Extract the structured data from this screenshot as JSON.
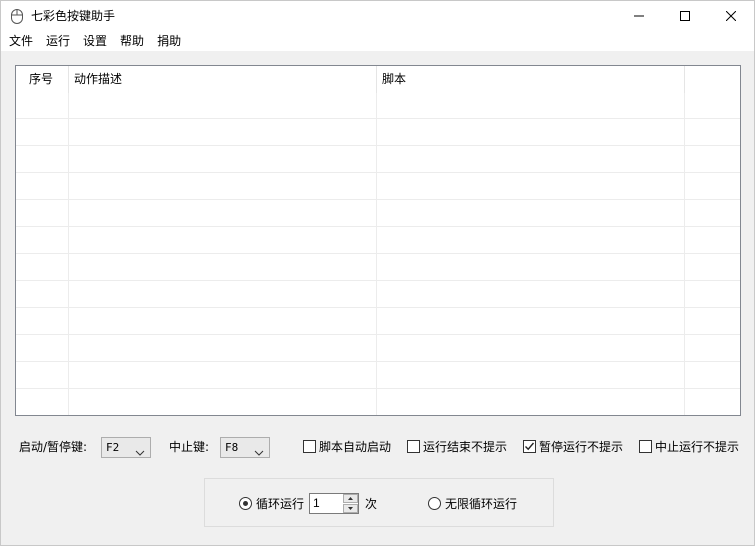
{
  "window": {
    "title": "七彩色按键助手"
  },
  "menu": [
    "文件",
    "运行",
    "设置",
    "帮助",
    "捐助"
  ],
  "table": {
    "columns": [
      "序号",
      "动作描述",
      "脚本",
      ""
    ]
  },
  "controls": {
    "start_pause_label": "启动/暂停键:",
    "start_pause_value": "F2",
    "stop_label": "中止键:",
    "stop_value": "F8",
    "checkboxes": [
      {
        "label": "脚本自动启动",
        "checked": false
      },
      {
        "label": "运行结束不提示",
        "checked": false
      },
      {
        "label": "暂停运行不提示",
        "checked": true
      },
      {
        "label": "中止运行不提示",
        "checked": false
      }
    ]
  },
  "loop": {
    "loop_label": "循环运行",
    "loop_selected": true,
    "count_value": "1",
    "count_unit": "次",
    "infinite_label": "无限循环运行",
    "infinite_selected": false
  }
}
